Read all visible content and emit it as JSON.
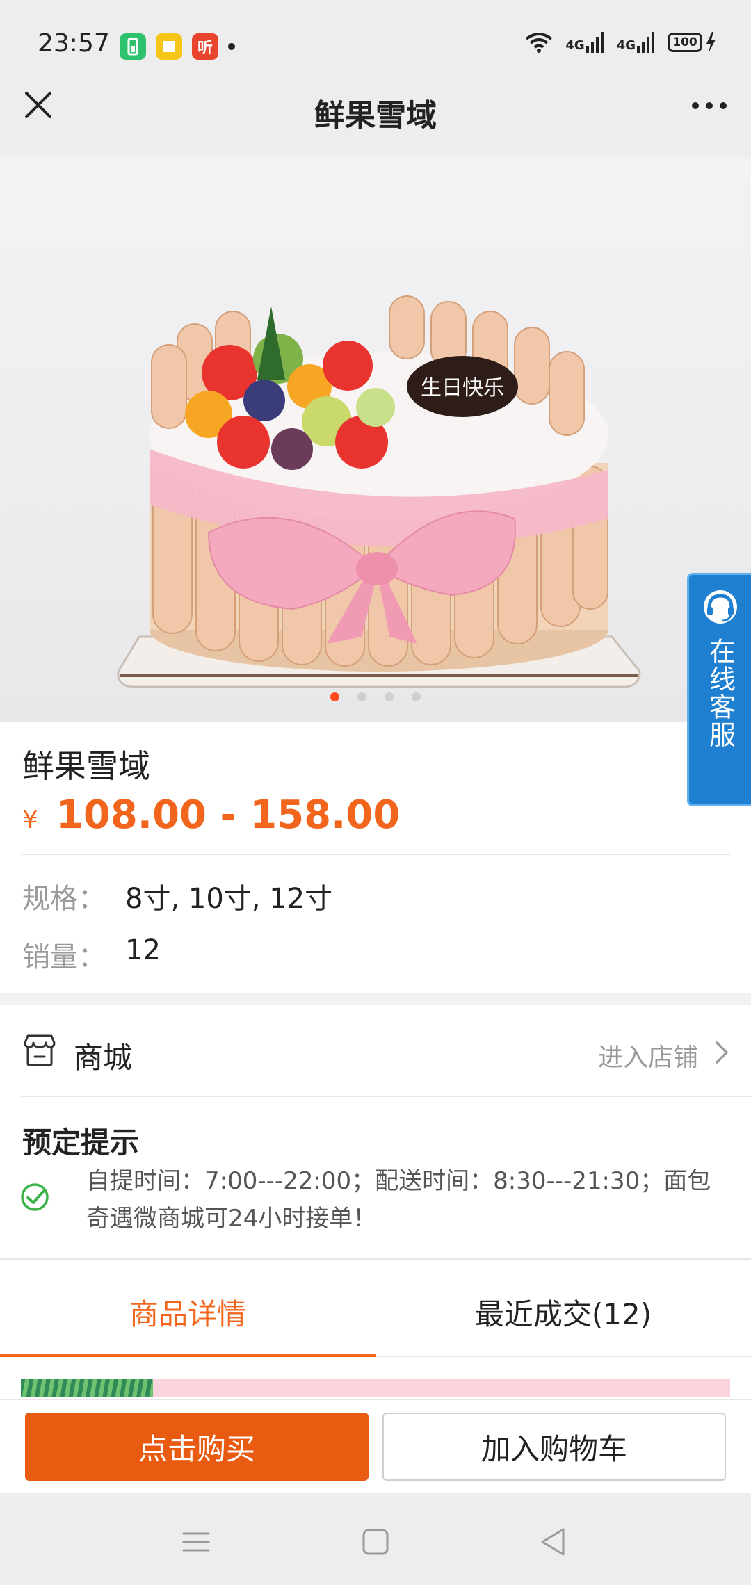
{
  "status_bar": {
    "time": "23:57",
    "apps": [
      {
        "icon": "battery-app-icon",
        "glyph": "▮",
        "color": "#2ec26e"
      },
      {
        "icon": "notes-app-icon",
        "glyph": "▤",
        "color": "#f5c518"
      },
      {
        "icon": "listen-app-icon",
        "glyph": "听",
        "color": "#e8442e"
      }
    ],
    "signal_1": "4G",
    "signal_2": "4G",
    "battery": "100"
  },
  "nav": {
    "title": "鲜果雪域"
  },
  "hero": {
    "cake_topper_text": "生日快乐",
    "slide_count": 4,
    "active_slide": 1,
    "accent": "#ff4a1a"
  },
  "service": {
    "label": "在线客服"
  },
  "product": {
    "name": "鲜果雪域",
    "currency": "¥",
    "price": "108.00 - 158.00",
    "spec_label": "规格：",
    "spec_value": "8寸, 10寸, 12寸",
    "sales_label": "销量：",
    "sales_value": "12"
  },
  "shop": {
    "label": "商城",
    "enter": "进入店铺"
  },
  "notice": {
    "title": "预定提示",
    "text": "自提时间：7:00---22:00；配送时间：8:30---21:30；面包奇遇微商城可24小时接单！"
  },
  "tabs": [
    {
      "label": "商品详情",
      "active": true
    },
    {
      "label": "最近成交(12)",
      "active": false
    }
  ],
  "actions": {
    "buy": "点击购买",
    "cart": "加入购物车",
    "buy_color": "#ea5b12"
  },
  "colors": {
    "accent": "#f2651c",
    "service_blue": "#1f7fd1"
  }
}
